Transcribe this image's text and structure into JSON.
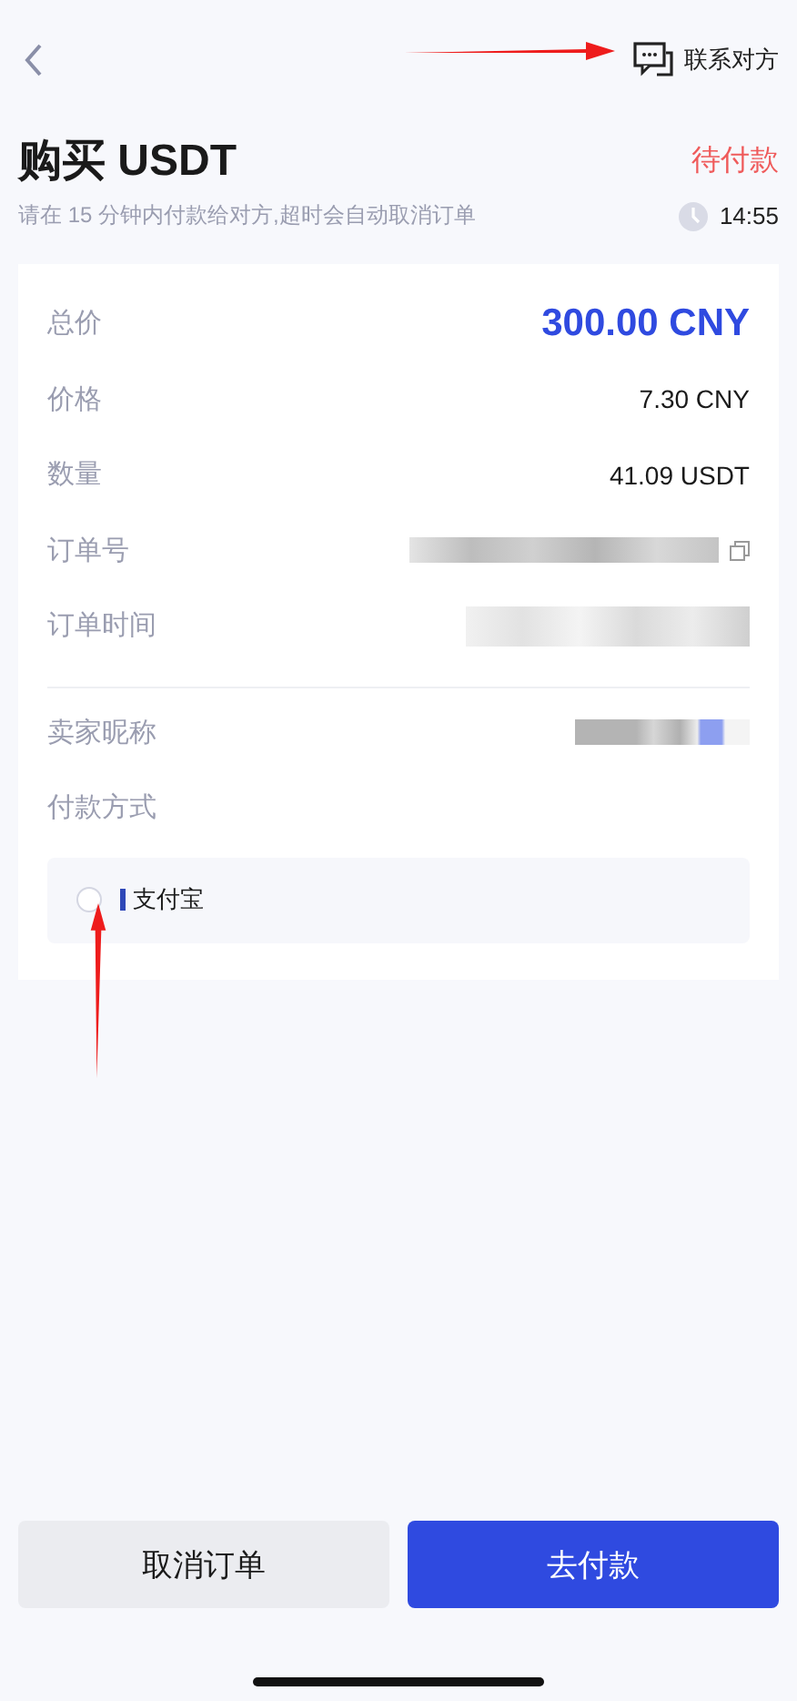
{
  "header": {
    "contact_label": "联系对方"
  },
  "title": "购买 USDT",
  "status": "待付款",
  "notice": "请在 15 分钟内付款给对方,超时会自动取消订单",
  "countdown": "14:55",
  "details": [
    {
      "kind": "total",
      "label": "总价",
      "value": "300.00 CNY"
    },
    {
      "kind": "text",
      "label": "价格",
      "value": "7.30 CNY"
    },
    {
      "kind": "text",
      "label": "数量",
      "value": "41.09 USDT"
    },
    {
      "kind": "redacted-copy",
      "label": "订单号"
    },
    {
      "kind": "redacted",
      "label": "订单时间"
    },
    {
      "kind": "divider"
    },
    {
      "kind": "redacted-short",
      "label": "卖家昵称"
    },
    {
      "kind": "heading",
      "label": "付款方式"
    }
  ],
  "payment_methods": [
    {
      "name": "支付宝",
      "selected": false,
      "color": "#2f48b8"
    }
  ],
  "buttons": [
    {
      "kind": "secondary",
      "label": "取消订单"
    },
    {
      "kind": "primary",
      "label": "去付款"
    }
  ]
}
